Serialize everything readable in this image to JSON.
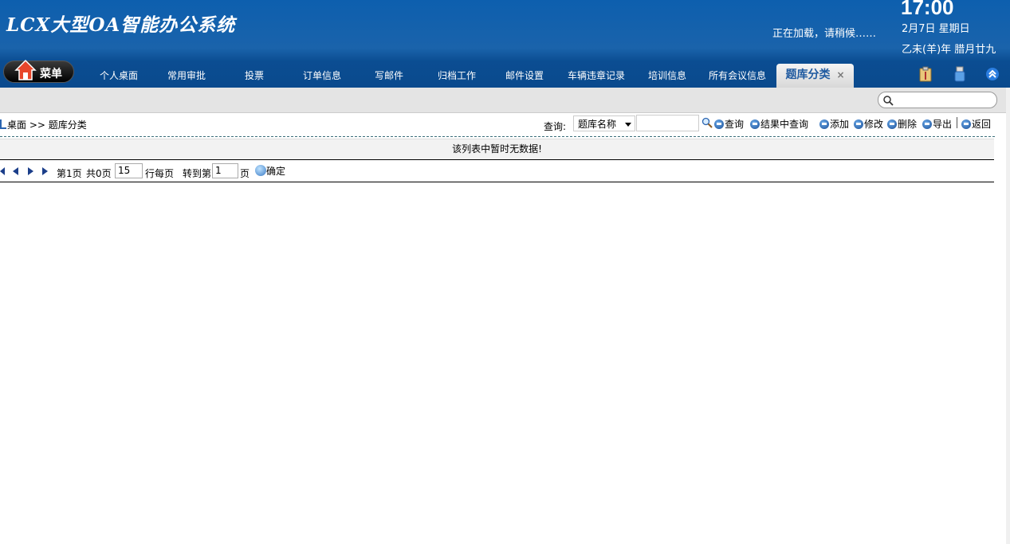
{
  "header": {
    "title": "LCX大型OA智能办公系统",
    "loading": "正在加载，请稍候……",
    "time": "17:00",
    "date": "2月7日 星期日",
    "lunar": "乙未(羊)年 腊月廿九"
  },
  "menu": {
    "label": "菜单",
    "icon": "home-icon"
  },
  "tabs": [
    {
      "label": "个人桌面"
    },
    {
      "label": "常用审批"
    },
    {
      "label": "投票"
    },
    {
      "label": "订单信息"
    },
    {
      "label": "写邮件"
    },
    {
      "label": "归档工作"
    },
    {
      "label": "邮件设置"
    },
    {
      "label": "车辆违章记录"
    },
    {
      "label": "培训信息"
    },
    {
      "label": "所有会议信息"
    },
    {
      "label": "题库分类",
      "close": "×"
    }
  ],
  "header_icons": [
    "clipboard-icon",
    "usb-icon",
    "collapse-icon"
  ],
  "breadcrumb": {
    "home": "桌面",
    "separator": ">>",
    "current": "题库分类"
  },
  "query": {
    "label": "查询:",
    "field": "题库名称",
    "input": "",
    "actions": [
      "查询",
      "结果中查询",
      "添加",
      "修改",
      "删除",
      "导出",
      "返回"
    ]
  },
  "table": {
    "empty_message": "该列表中暂时无数据!"
  },
  "pager": {
    "page_text": "第1页",
    "total_text": "共0页",
    "rows_per_page": "15",
    "rows_label": "行每页",
    "goto_label": "转到第",
    "goto_value": "1",
    "page_unit": "页",
    "confirm": "确定"
  },
  "colors": {
    "header_blue": "#0d5fae",
    "active_tab_text": "#1f5aa0",
    "toolbar_gray": "#e4e4e4"
  }
}
